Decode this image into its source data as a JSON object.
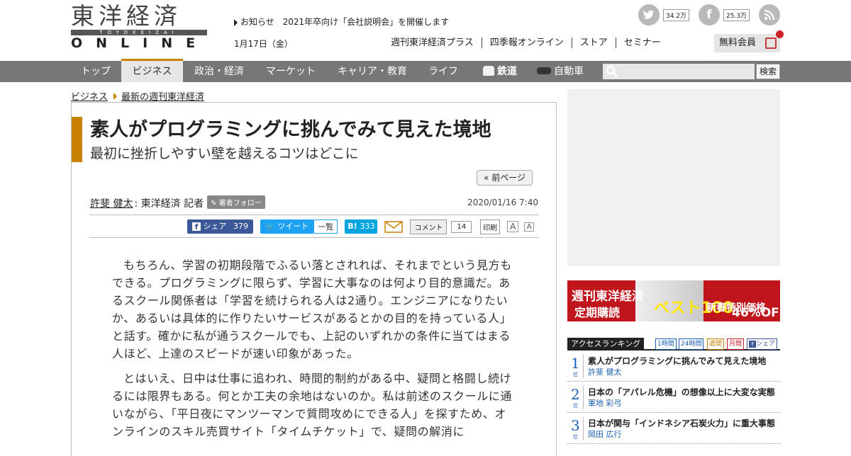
{
  "header": {
    "logo_kanji": "東洋経済",
    "logo_bar": "TOYOKEIZAI",
    "logo_online": "ONLINE",
    "notice_label": "お知らせ",
    "notice_text": "2021年卒向け「会社説明会」を開催します",
    "date": "1月17日（金）",
    "top_links": [
      "週刊東洋経済プラス",
      "四季報オンライン",
      "ストア",
      "セミナー"
    ],
    "member_label": "無料会員",
    "twitter_count": "34.2万",
    "facebook_count": "25.3万"
  },
  "nav": {
    "items": [
      "トップ",
      "ビジネス",
      "政治・経済",
      "マーケット",
      "キャリア・教育",
      "ライフ",
      "鉄道",
      "自動車"
    ],
    "active_index": 1,
    "search_button": "検索"
  },
  "breadcrumb": {
    "items": [
      "ビジネス",
      "最新の週刊東洋経済"
    ]
  },
  "article": {
    "title": "素人がプログラミングに挑んでみて見えた境地",
    "subtitle": "最初に挫折しやすい壁を越えるコツはどこに",
    "prev_page": "« 前ページ",
    "author_name": "許斐 健太",
    "author_role": ": 東洋経済 記者",
    "follow_label": "著者フォロー",
    "published": "2020/01/16 7:40",
    "share": {
      "facebook_label": "シェア",
      "facebook_count": "379",
      "tweet_label": "ツイート",
      "list_label": "一覧",
      "hatena_label": "B!",
      "hatena_count": "333",
      "comment_label": "コメント",
      "comment_count": "14",
      "print_label": "印刷",
      "font_large": "A",
      "font_small": "A"
    },
    "paragraphs": [
      "もちろん、学習の初期段階でふるい落とされれば、それまでという見方もできる。プログラミングに限らず、学習に大事なのは何より目的意識だ。あるスクール関係者は「学習を続けられる人は2通り。エンジニアになりたいか、あるいは具体的に作りたいサービスがあるとかの目的を持っている人」と話す。確かに私が通うスクールでも、上記のいずれかの条件に当てはまる人ほど、上達のスピードが速い印象があった。",
      "とはいえ、日中は仕事に追われ、時間的制約がある中、疑問と格闘し続けるには限界もある。何とか工夫の余地はないのか。私は前述のスクールに通いながら、「平日夜にマンツーマンで質問攻めにできる人」を探すため、オンラインのスキル売買サイト「タイムチケット」で、疑問の解消に"
    ]
  },
  "sidebar": {
    "promo": {
      "left_top": "週刊東洋経済",
      "left_bottom": "定期購読",
      "center": "ベスト100",
      "right_label": "新春特別価格",
      "right_value": "46%OFF"
    },
    "ranking": {
      "title": "アクセスランキング",
      "tabs": [
        "1時間",
        "24時間",
        "週間",
        "月間",
        "シェア"
      ],
      "items": [
        {
          "rank": "1",
          "suffix": "位",
          "title": "素人がプログラミングに挑んでみて見えた境地",
          "author": "許斐 健太"
        },
        {
          "rank": "2",
          "suffix": "位",
          "title": "日本の「アパレル危機」の想像以上に大変な実態",
          "author": "軍地 彩弓"
        },
        {
          "rank": "3",
          "suffix": "位",
          "title": "日本が関与「インドネシア石炭火力」に重大事態",
          "author": "岡田 広行"
        }
      ]
    }
  },
  "colors": {
    "accent": "#c88100",
    "nav_bg": "#777777",
    "facebook": "#3b5998",
    "twitter": "#1da1f2",
    "hatena": "#00a4de",
    "rank_blue": "#1a5fb4"
  }
}
